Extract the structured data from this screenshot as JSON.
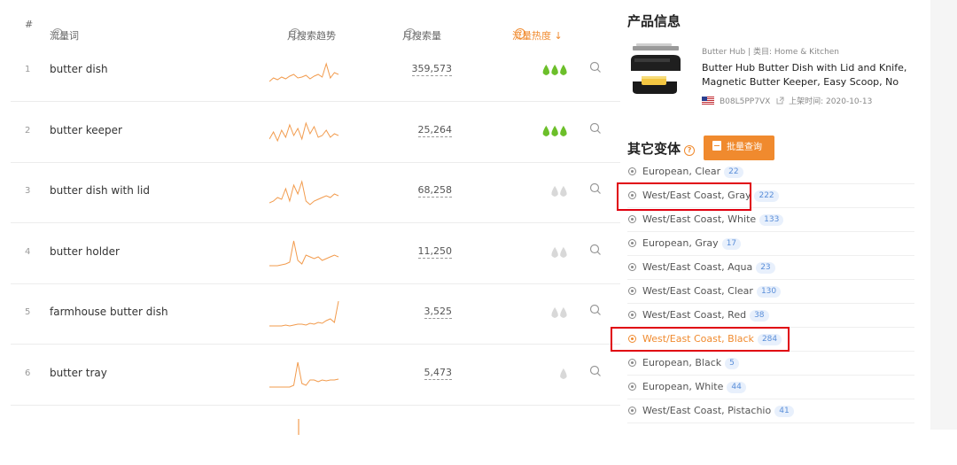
{
  "table": {
    "headers": {
      "index": "#",
      "keyword": "流量词",
      "trend": "月搜索趋势",
      "volume": "月搜索量",
      "heat": "流量热度 ↓"
    },
    "rows": [
      {
        "index": "1",
        "keyword": "butter dish",
        "volume": "359,573",
        "heat": 3,
        "heat_active": true
      },
      {
        "index": "2",
        "keyword": "butter keeper",
        "volume": "25,264",
        "heat": 3,
        "heat_active": true
      },
      {
        "index": "3",
        "keyword": "butter dish with lid",
        "volume": "68,258",
        "heat": 2,
        "heat_active": false
      },
      {
        "index": "4",
        "keyword": "butter holder",
        "volume": "11,250",
        "heat": 2,
        "heat_active": false
      },
      {
        "index": "5",
        "keyword": "farmhouse butter dish",
        "volume": "3,525",
        "heat": 2,
        "heat_active": false
      },
      {
        "index": "6",
        "keyword": "butter tray",
        "volume": "5,473",
        "heat": 1,
        "heat_active": false
      }
    ]
  },
  "product": {
    "section_title": "产品信息",
    "meta": "Butter Hub | 类目: Home & Kitchen",
    "name": "Butter Hub Butter Dish with Lid and Knife, Magnetic Butter Keeper, Easy Scoop, No Mes...",
    "asin": "B08L5PP7VX",
    "listed": "上架时间: 2020-10-13"
  },
  "variants": {
    "title": "其它变体",
    "batch_button": "批量查询",
    "items": [
      {
        "label": "European, Clear",
        "count": "22"
      },
      {
        "label": "West/East Coast, Gray",
        "count": "222"
      },
      {
        "label": "West/East Coast, White",
        "count": "133"
      },
      {
        "label": "European, Gray",
        "count": "17"
      },
      {
        "label": "West/East Coast, Aqua",
        "count": "23"
      },
      {
        "label": "West/East Coast, Clear",
        "count": "130"
      },
      {
        "label": "West/East Coast, Red",
        "count": "38"
      },
      {
        "label": "West/East Coast, Black",
        "count": "284"
      },
      {
        "label": "European, Black",
        "count": "5"
      },
      {
        "label": "European, White",
        "count": "44"
      },
      {
        "label": "West/East Coast, Pistachio",
        "count": "41"
      }
    ]
  },
  "colors": {
    "accent": "#f08a2e",
    "heat_green": "#6cbf2a",
    "heat_grey": "#d8d8d8",
    "highlight_box": "#e0000f",
    "count_badge_bg": "#e8f0fc"
  }
}
